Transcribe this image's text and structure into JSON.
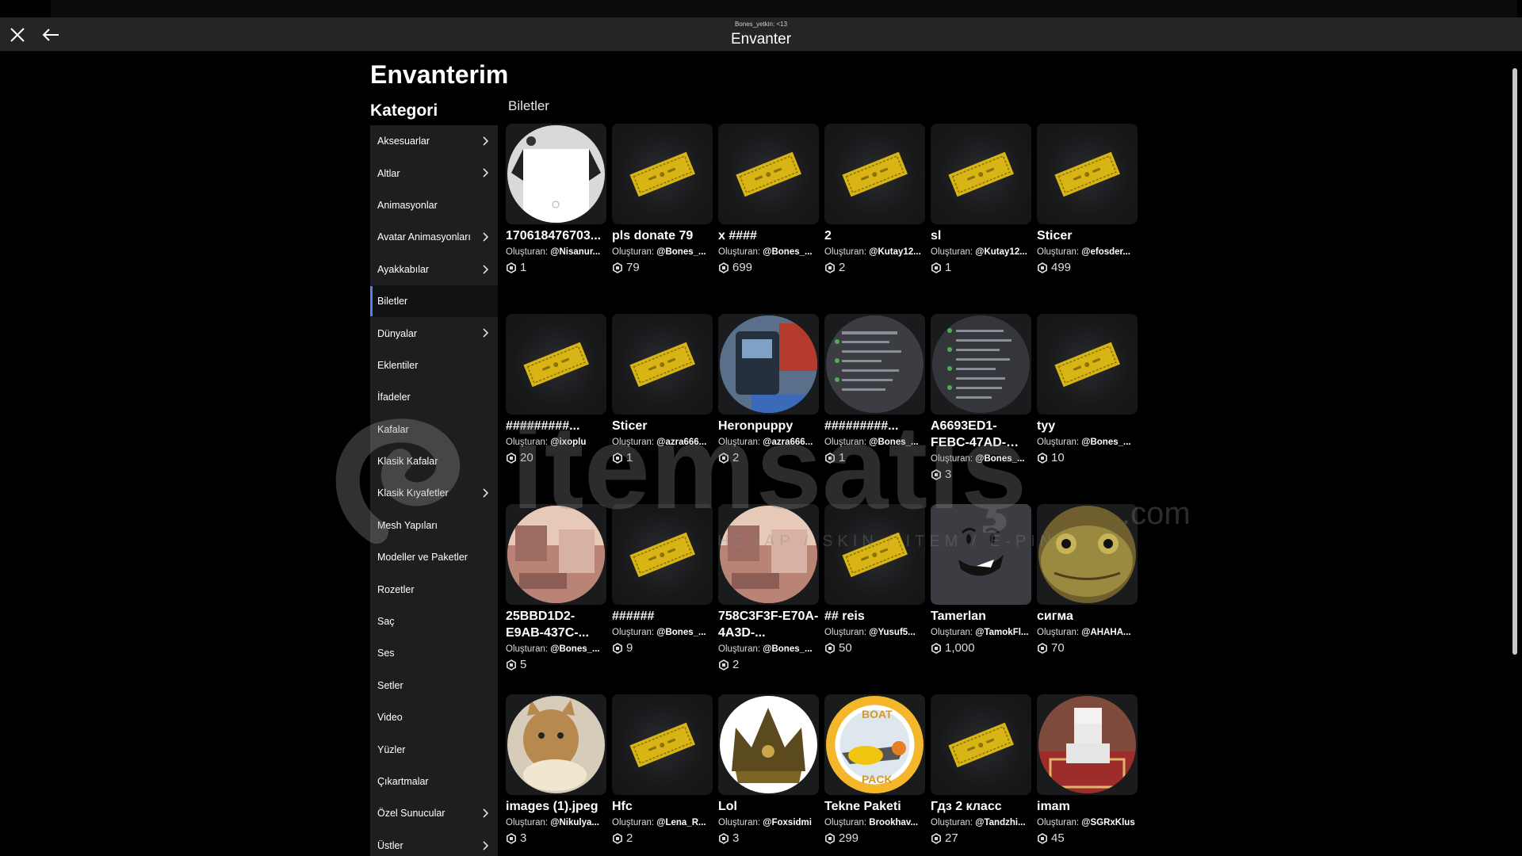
{
  "window": {
    "user_line": "Bones_yetkin: <13",
    "title": "Envanter"
  },
  "page": {
    "title": "Envanterim",
    "category_title": "Kategori",
    "section_title": "Biletler"
  },
  "sidebar": {
    "items": [
      {
        "label": "Aksesuarlar",
        "chevron": true,
        "active": false
      },
      {
        "label": "Altlar",
        "chevron": true,
        "active": false
      },
      {
        "label": "Animasyonlar",
        "chevron": false,
        "active": false
      },
      {
        "label": "Avatar Animasyonları",
        "chevron": true,
        "active": false
      },
      {
        "label": "Ayakkabılar",
        "chevron": true,
        "active": false
      },
      {
        "label": "Biletler",
        "chevron": false,
        "active": true
      },
      {
        "label": "Dünyalar",
        "chevron": true,
        "active": false
      },
      {
        "label": "Eklentiler",
        "chevron": false,
        "active": false
      },
      {
        "label": "İfadeler",
        "chevron": false,
        "active": false
      },
      {
        "label": "Kafalar",
        "chevron": false,
        "active": false
      },
      {
        "label": "Klasik Kafalar",
        "chevron": false,
        "active": false
      },
      {
        "label": "Klasik Kıyafetler",
        "chevron": true,
        "active": false
      },
      {
        "label": "Mesh Yapıları",
        "chevron": false,
        "active": false
      },
      {
        "label": "Modeller ve Paketler",
        "chevron": false,
        "active": false
      },
      {
        "label": "Rozetler",
        "chevron": false,
        "active": false
      },
      {
        "label": "Saç",
        "chevron": false,
        "active": false
      },
      {
        "label": "Ses",
        "chevron": false,
        "active": false
      },
      {
        "label": "Setler",
        "chevron": false,
        "active": false
      },
      {
        "label": "Video",
        "chevron": false,
        "active": false
      },
      {
        "label": "Yüzler",
        "chevron": false,
        "active": false
      },
      {
        "label": "Çıkartmalar",
        "chevron": false,
        "active": false
      },
      {
        "label": "Özel Sunucular",
        "chevron": true,
        "active": false
      },
      {
        "label": "Üstler",
        "chevron": true,
        "active": false
      }
    ]
  },
  "creator_prefix": "Oluşturan:",
  "items": [
    {
      "name": "170618476703...",
      "creator": "@Nisanur...",
      "price": "1",
      "thumb": "shirt"
    },
    {
      "name": "pls donate 79",
      "creator": "@Bones_...",
      "price": "79",
      "thumb": "ticket"
    },
    {
      "name": "x ####",
      "creator": "@Bones_...",
      "price": "699",
      "thumb": "ticket"
    },
    {
      "name": "2",
      "creator": "@Kutay12...",
      "price": "2",
      "thumb": "ticket"
    },
    {
      "name": "sl",
      "creator": "@Kutay12...",
      "price": "1",
      "thumb": "ticket"
    },
    {
      "name": "Sticer",
      "creator": "@efosder...",
      "price": "499",
      "thumb": "ticket"
    },
    {
      "name": "#########...",
      "creator": "@ixoplu",
      "price": "20",
      "thumb": "ticket"
    },
    {
      "name": "Sticer",
      "creator": "@azra666...",
      "price": "1",
      "thumb": "ticket"
    },
    {
      "name": "Heronpuppy",
      "creator": "@azra666...",
      "price": "2",
      "thumb": "device"
    },
    {
      "name": "#########...",
      "creator": "@Bones_...",
      "price": "1",
      "thumb": "chat"
    },
    {
      "name": "A6693ED1-FEBC-47AD-8EF9-...",
      "creator": "@Bones_...",
      "price": "3",
      "thumb": "chat2",
      "wrap": true
    },
    {
      "name": "tyy",
      "creator": "@Bones_...",
      "price": "10",
      "thumb": "ticket"
    },
    {
      "name": "25BBD1D2-E9AB-437C-...",
      "creator": "@Bones_...",
      "price": "5",
      "thumb": "room",
      "wrap": true
    },
    {
      "name": "######",
      "creator": "@Bones_...",
      "price": "9",
      "thumb": "ticket"
    },
    {
      "name": "758C3F3F-E70A-4A3D-...",
      "creator": "@Bones_...",
      "price": "2",
      "thumb": "room",
      "wrap": true
    },
    {
      "name": "## reis",
      "creator": "@Yusuf5...",
      "price": "50",
      "thumb": "ticket"
    },
    {
      "name": "Tamerlan",
      "creator": "@TamokFl...",
      "price": "1,000",
      "thumb": "face"
    },
    {
      "name": "сигма",
      "creator": "@AHAHA...",
      "price": "70",
      "thumb": "frog"
    },
    {
      "name": "images (1).jpeg",
      "creator": "@Nikulya...",
      "price": "3",
      "thumb": "cat"
    },
    {
      "name": "Hfc",
      "creator": "@Lena_R...",
      "price": "2",
      "thumb": "ticket"
    },
    {
      "name": "Lol",
      "creator": "@Foxsidmi",
      "price": "3",
      "thumb": "crown"
    },
    {
      "name": "Tekne Paketi",
      "creator": "Brookhav...",
      "price": "299",
      "thumb": "boat"
    },
    {
      "name": "Гдз 2 класс",
      "creator": "@Tandzhi...",
      "price": "27",
      "thumb": "ticket"
    },
    {
      "name": "imam",
      "creator": "@SGRxKlus",
      "price": "45",
      "thumb": "imam"
    }
  ],
  "watermark": {
    "brand": "itemsatış",
    "tagline": "HESAP / SKIN / ITEM / E-PIN",
    "suffix": ".com"
  },
  "colors": {
    "accent": "#5b7ee8",
    "sidebar": "#1d1e20",
    "titlebar": "#232527",
    "ticket": "#d8b414"
  }
}
